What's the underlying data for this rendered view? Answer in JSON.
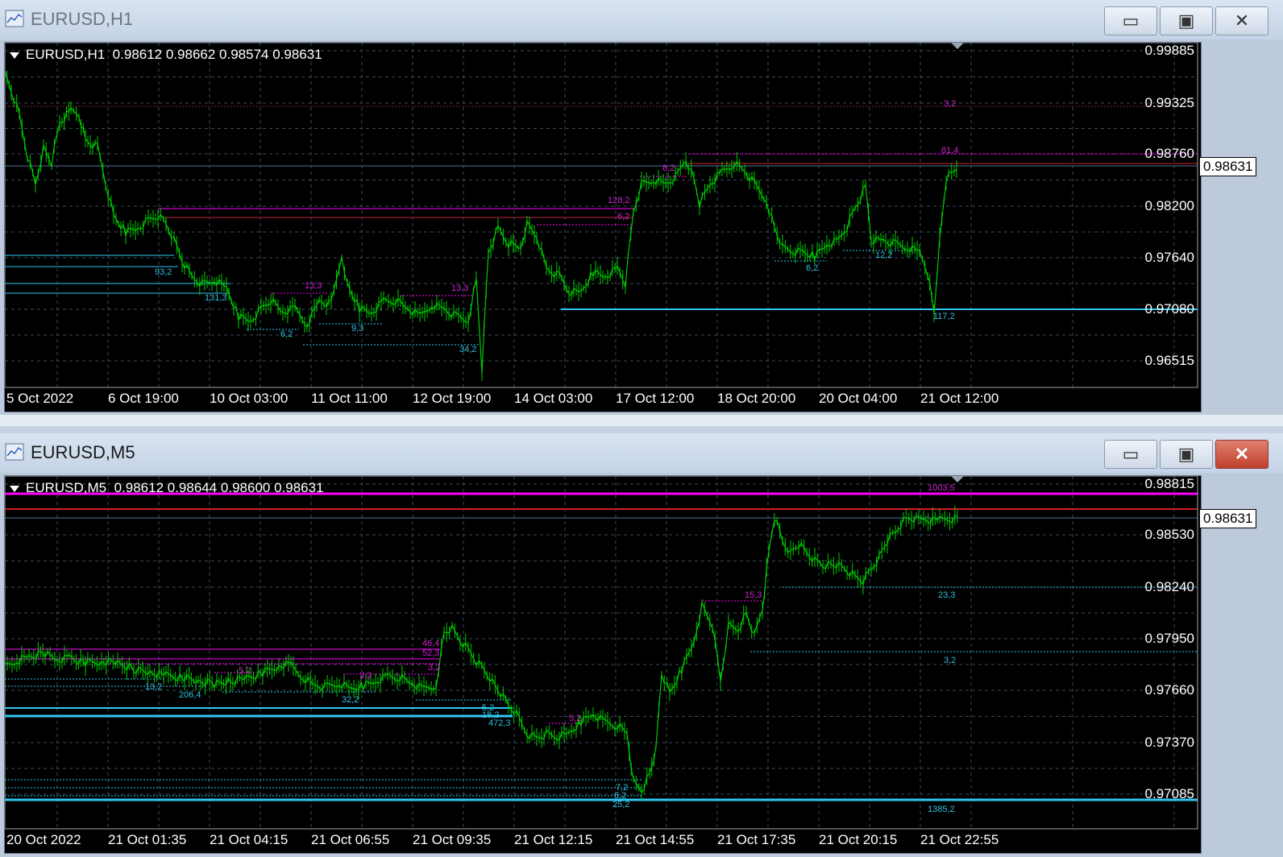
{
  "windows": [
    {
      "title": "EURUSD,H1",
      "active": false,
      "header": "EURUSD,H1  0.98612 0.98662 0.98574 0.98631",
      "current_price": "0.98631",
      "price_labels": [
        "0.99885",
        "0.99325",
        "0.98760",
        "0.98200",
        "0.97640",
        "0.97080",
        "0.96515"
      ],
      "time_labels": [
        "5 Oct 2022",
        "6 Oct 19:00",
        "10 Oct 03:00",
        "11 Oct 11:00",
        "12 Oct 19:00",
        "14 Oct 03:00",
        "17 Oct 12:00",
        "18 Oct 20:00",
        "20 Oct 04:00",
        "21 Oct 12:00"
      ],
      "level_labels": [
        {
          "text": "3,2",
          "color": "#d020d0"
        },
        {
          "text": "81,4",
          "color": "#d020d0"
        },
        {
          "text": "8,2",
          "color": "#d020d0"
        },
        {
          "text": "128,2",
          "color": "#d020d0"
        },
        {
          "text": "6,2",
          "color": "#d020d0"
        },
        {
          "text": "13,3",
          "color": "#d020d0"
        },
        {
          "text": "13,3",
          "color": "#d020d0"
        },
        {
          "text": "93,2",
          "color": "#30c0e0"
        },
        {
          "text": "131,3",
          "color": "#30c0e0"
        },
        {
          "text": "6,2",
          "color": "#30c0e0"
        },
        {
          "text": "9,3",
          "color": "#30c0e0"
        },
        {
          "text": "34,2",
          "color": "#30c0e0"
        },
        {
          "text": "6,2",
          "color": "#30c0e0"
        },
        {
          "text": "12,2",
          "color": "#30c0e0"
        },
        {
          "text": "117,2",
          "color": "#30c0e0"
        }
      ]
    },
    {
      "title": "EURUSD,M5",
      "active": true,
      "header": "EURUSD,M5  0.98612 0.98644 0.98600 0.98631",
      "current_price": "0.98631",
      "price_labels": [
        "0.98815",
        "0.98530",
        "0.98240",
        "0.97950",
        "0.97660",
        "0.97370",
        "0.97085"
      ],
      "time_labels": [
        "20 Oct 2022",
        "21 Oct 01:35",
        "21 Oct 04:15",
        "21 Oct 06:55",
        "21 Oct 09:35",
        "21 Oct 12:15",
        "21 Oct 14:55",
        "21 Oct 17:35",
        "21 Oct 20:15",
        "21 Oct 22:55"
      ],
      "level_labels": [
        {
          "text": "1003,5",
          "color": "#d020d0"
        },
        {
          "text": "15,3",
          "color": "#d020d0"
        },
        {
          "text": "46,4",
          "color": "#d020d0"
        },
        {
          "text": "52,3",
          "color": "#d020d0"
        },
        {
          "text": "3,2",
          "color": "#d020d0"
        },
        {
          "text": "5,2",
          "color": "#d020d0"
        },
        {
          "text": "3,2",
          "color": "#d020d0"
        },
        {
          "text": "5,2",
          "color": "#d020d0"
        },
        {
          "text": "23,3",
          "color": "#30c0e0"
        },
        {
          "text": "3,2",
          "color": "#30c0e0"
        },
        {
          "text": "13,2",
          "color": "#30c0e0"
        },
        {
          "text": "206,4",
          "color": "#30c0e0"
        },
        {
          "text": "32,2",
          "color": "#30c0e0"
        },
        {
          "text": "5,2",
          "color": "#30c0e0"
        },
        {
          "text": "18,2",
          "color": "#30c0e0"
        },
        {
          "text": "472,3",
          "color": "#30c0e0"
        },
        {
          "text": "7,2",
          "color": "#30c0e0"
        },
        {
          "text": "6,2",
          "color": "#30c0e0"
        },
        {
          "text": "25,2",
          "color": "#30c0e0"
        },
        {
          "text": "1385,2",
          "color": "#30c0e0"
        }
      ]
    }
  ],
  "window_buttons": {
    "minimize": "▭",
    "maximize": "▣",
    "close": "✕"
  },
  "colors": {
    "candle": "#00cc00",
    "grid": "#3a4a5a",
    "magenta": "#ff00ff",
    "cyan": "#30c8f0",
    "red": "#d02020"
  }
}
